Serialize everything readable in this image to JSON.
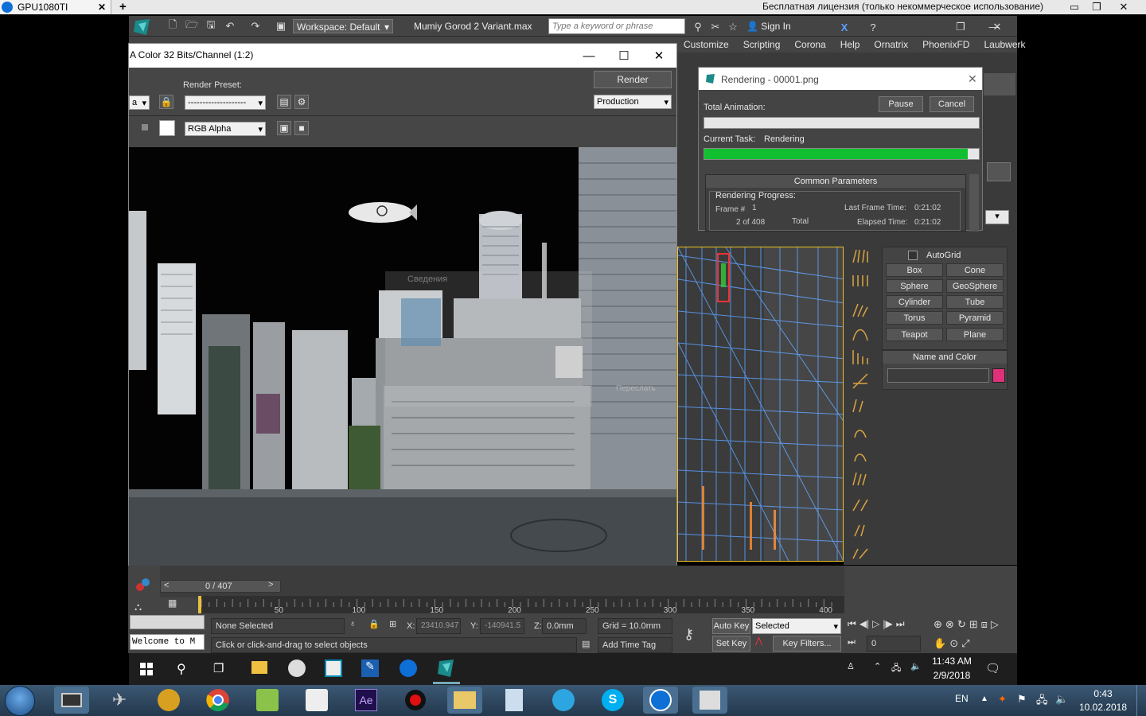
{
  "teamviewer": {
    "tab_label": "GPU1080TI",
    "license_text": "Бесплатная лицензия (только некоммерческое использование)"
  },
  "max": {
    "workspace": "Workspace: Default",
    "file_title": "Mumiy Gorod 2 Variant.max",
    "search_placeholder": "Type a keyword or phrase",
    "sign_in": "Sign In",
    "menu": [
      "Customize",
      "Scripting",
      "Corona",
      "Help",
      "Ornatrix",
      "PhoenixFD",
      "Laubwerk"
    ]
  },
  "frame_window": {
    "title": "A Color 32 Bits/Channel (1:2)",
    "render_preset_label": "Render Preset:",
    "preset_value": "--------------------",
    "render_button": "Render",
    "production": "Production",
    "channel": "RGB Alpha",
    "ghost_dialog_title": "Сведения",
    "ghost_button": "Переслать"
  },
  "rendering_dialog": {
    "title": "Rendering - 00001.png",
    "pause": "Pause",
    "cancel": "Cancel",
    "total_animation": "Total Animation:",
    "current_task_label": "Current Task:",
    "current_task_value": "Rendering",
    "current_progress": 0.96,
    "common_parameters": "Common Parameters",
    "rendering_progress": "Rendering Progress:",
    "frame_label": "Frame #",
    "frame_value": "1",
    "of_frames": "2 of 408",
    "total": "Total",
    "last_frame_time_label": "Last Frame Time:",
    "last_frame_time": "0:21:02",
    "elapsed_time_label": "Elapsed Time:",
    "elapsed_time": "0:21:02"
  },
  "command_panel": {
    "autogrid": "AutoGrid",
    "objects": [
      "Box",
      "Cone",
      "Sphere",
      "GeoSphere",
      "Cylinder",
      "Tube",
      "Torus",
      "Pyramid",
      "Teapot",
      "Plane"
    ],
    "name_and_color": "Name and Color",
    "object_color": "#e0307a"
  },
  "timeline": {
    "frame_counter": "0 / 407",
    "ticks": [
      "50",
      "100",
      "150",
      "200",
      "250",
      "300",
      "350",
      "400"
    ],
    "none_selected": "None Selected",
    "prompt": "Click or click-and-drag to select objects",
    "x_label": "X:",
    "x": "23410.947",
    "y_label": "Y:",
    "y": "-140941.5",
    "z_label": "Z:",
    "z": "0.0mm",
    "grid": "Grid = 10.0mm",
    "add_time_tag": "Add Time Tag",
    "auto_key": "Auto Key",
    "set_key": "Set Key",
    "selected": "Selected",
    "key_filters": "Key Filters...",
    "frame_field": "0",
    "maxscript": "Welcome to M"
  },
  "inner_taskbar": {
    "time": "11:43 AM",
    "date": "2/9/2018"
  },
  "taskbar": {
    "lang": "EN",
    "time": "0:43",
    "date": "10.02.2018"
  }
}
